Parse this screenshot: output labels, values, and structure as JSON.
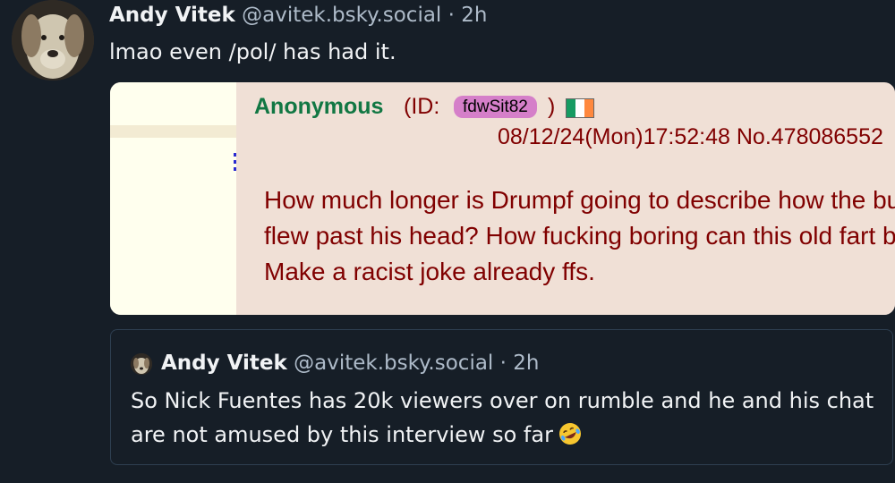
{
  "post": {
    "author_name": "Andy Vitek",
    "author_handle": "@avitek.bsky.social",
    "separator": "·",
    "time": "2h",
    "text": "lmao even /pol/ has had it."
  },
  "embed": {
    "name": "Anonymous",
    "id_prefix": "(ID: ",
    "id_value": "fdwSit82",
    "id_suffix": ")",
    "flag_colors": [
      "#169b62",
      "#ffffff",
      "#ff883e"
    ],
    "date_line": "08/12/24(Mon)17:52:48 No.478086552",
    "body": "How much longer is Drumpf going to describe how the bullet flew past his head? How fucking boring can this old fart be. Make a racist joke already ffs."
  },
  "quote": {
    "author_name": "Andy Vitek",
    "author_handle": "@avitek.bsky.social",
    "separator": "·",
    "time": "2h",
    "text": "So Nick Fuentes has 20k viewers over on rumble and he and his chat are not amused by this interview so far",
    "emoji": "rolling-on-floor-laughing-icon"
  },
  "colors": {
    "background": "#161e27",
    "muted": "#aebbc9",
    "chan_green": "#117743",
    "chan_maroon": "#800000",
    "chan_bg": "#f0e0d6",
    "id_badge": "#d57fc9"
  }
}
